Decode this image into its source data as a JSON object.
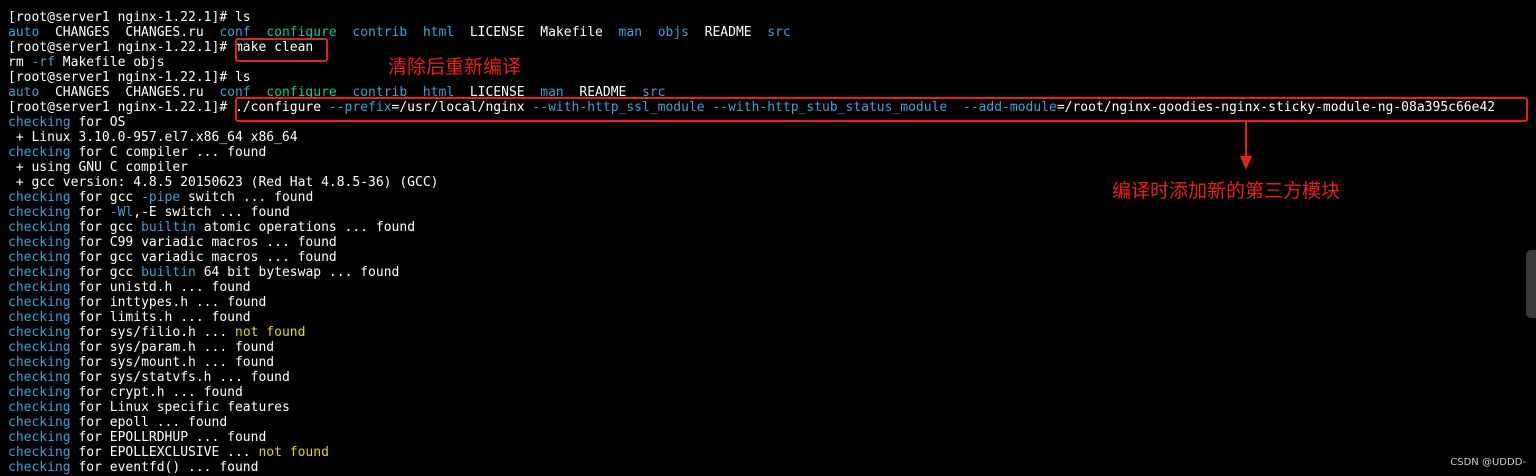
{
  "terminal": {
    "lines": [
      {
        "segments": [
          {
            "t": "[root@server1 nginx-1.22.1]# ls",
            "c": "w"
          }
        ]
      },
      {
        "segments": [
          {
            "t": "auto",
            "c": "c"
          },
          {
            "t": "  CHANGES  CHANGES.ru  ",
            "c": "w"
          },
          {
            "t": "conf",
            "c": "c"
          },
          {
            "t": "  ",
            "c": "w"
          },
          {
            "t": "configure",
            "c": "g"
          },
          {
            "t": "  ",
            "c": "w"
          },
          {
            "t": "contrib",
            "c": "c"
          },
          {
            "t": "  ",
            "c": "w"
          },
          {
            "t": "html",
            "c": "c"
          },
          {
            "t": "  LICENSE  Makefile  ",
            "c": "w"
          },
          {
            "t": "man",
            "c": "c"
          },
          {
            "t": "  ",
            "c": "w"
          },
          {
            "t": "objs",
            "c": "c"
          },
          {
            "t": "  README  ",
            "c": "w"
          },
          {
            "t": "src",
            "c": "c"
          }
        ]
      },
      {
        "segments": [
          {
            "t": "[root@server1 nginx-1.22.1]# make clean",
            "c": "w"
          }
        ]
      },
      {
        "segments": [
          {
            "t": "rm ",
            "c": "w"
          },
          {
            "t": "-rf",
            "c": "c"
          },
          {
            "t": " Makefile objs",
            "c": "w"
          }
        ]
      },
      {
        "segments": [
          {
            "t": "[root@server1 nginx-1.22.1]# ls",
            "c": "w"
          }
        ]
      },
      {
        "segments": [
          {
            "t": "auto",
            "c": "c"
          },
          {
            "t": "  CHANGES  CHANGES.ru  ",
            "c": "w"
          },
          {
            "t": "conf",
            "c": "c"
          },
          {
            "t": "  ",
            "c": "w"
          },
          {
            "t": "configure",
            "c": "g"
          },
          {
            "t": "  ",
            "c": "w"
          },
          {
            "t": "contrib",
            "c": "c"
          },
          {
            "t": "  ",
            "c": "w"
          },
          {
            "t": "html",
            "c": "c"
          },
          {
            "t": "  LICENSE  ",
            "c": "w"
          },
          {
            "t": "man",
            "c": "c"
          },
          {
            "t": "  README  ",
            "c": "w"
          },
          {
            "t": "src",
            "c": "c"
          }
        ]
      },
      {
        "segments": [
          {
            "t": "[root@server1 nginx-1.22.1]# ./configure ",
            "c": "w"
          },
          {
            "t": "--prefix",
            "c": "c"
          },
          {
            "t": "=/usr/local/nginx ",
            "c": "w"
          },
          {
            "t": "--with-http_ssl_module --with-http_stub_status_module  --add-module",
            "c": "c"
          },
          {
            "t": "=/root/nginx-goodies-nginx-sticky-module-ng-08a395c66e42",
            "c": "w"
          }
        ]
      },
      {
        "segments": [
          {
            "t": "checking",
            "c": "c"
          },
          {
            "t": " for OS",
            "c": "w"
          }
        ]
      },
      {
        "segments": [
          {
            "t": " + Linux 3.10.0-957.el7.x86_64 x86_64",
            "c": "w"
          }
        ]
      },
      {
        "segments": [
          {
            "t": "checking",
            "c": "c"
          },
          {
            "t": " for C compiler ... found",
            "c": "w"
          }
        ]
      },
      {
        "segments": [
          {
            "t": " + using GNU C compiler",
            "c": "w"
          }
        ]
      },
      {
        "segments": [
          {
            "t": " + gcc version: 4.8.5 20150623 (Red Hat 4.8.5-36) (GCC)",
            "c": "w"
          }
        ]
      },
      {
        "segments": [
          {
            "t": "checking",
            "c": "c"
          },
          {
            "t": " for gcc ",
            "c": "w"
          },
          {
            "t": "-pipe",
            "c": "c"
          },
          {
            "t": " switch ... found",
            "c": "w"
          }
        ]
      },
      {
        "segments": [
          {
            "t": "checking",
            "c": "c"
          },
          {
            "t": " for ",
            "c": "w"
          },
          {
            "t": "-Wl",
            "c": "c"
          },
          {
            "t": ",-E switch ... found",
            "c": "w"
          }
        ]
      },
      {
        "segments": [
          {
            "t": "checking",
            "c": "c"
          },
          {
            "t": " for gcc ",
            "c": "w"
          },
          {
            "t": "builtin",
            "c": "c"
          },
          {
            "t": " atomic operations ... found",
            "c": "w"
          }
        ]
      },
      {
        "segments": [
          {
            "t": "checking",
            "c": "c"
          },
          {
            "t": " for C99 variadic macros ... found",
            "c": "w"
          }
        ]
      },
      {
        "segments": [
          {
            "t": "checking",
            "c": "c"
          },
          {
            "t": " for gcc variadic macros ... found",
            "c": "w"
          }
        ]
      },
      {
        "segments": [
          {
            "t": "checking",
            "c": "c"
          },
          {
            "t": " for gcc ",
            "c": "w"
          },
          {
            "t": "builtin",
            "c": "c"
          },
          {
            "t": " 64 bit byteswap ... found",
            "c": "w"
          }
        ]
      },
      {
        "segments": [
          {
            "t": "checking",
            "c": "c"
          },
          {
            "t": " for unistd.h ... found",
            "c": "w"
          }
        ]
      },
      {
        "segments": [
          {
            "t": "checking",
            "c": "c"
          },
          {
            "t": " for inttypes.h ... found",
            "c": "w"
          }
        ]
      },
      {
        "segments": [
          {
            "t": "checking",
            "c": "c"
          },
          {
            "t": " for limits.h ... found",
            "c": "w"
          }
        ]
      },
      {
        "segments": [
          {
            "t": "checking",
            "c": "c"
          },
          {
            "t": " for sys/filio.h ... ",
            "c": "w"
          },
          {
            "t": "not found",
            "c": "y"
          }
        ]
      },
      {
        "segments": [
          {
            "t": "checking",
            "c": "c"
          },
          {
            "t": " for sys/param.h ... found",
            "c": "w"
          }
        ]
      },
      {
        "segments": [
          {
            "t": "checking",
            "c": "c"
          },
          {
            "t": " for sys/mount.h ... found",
            "c": "w"
          }
        ]
      },
      {
        "segments": [
          {
            "t": "checking",
            "c": "c"
          },
          {
            "t": " for sys/statvfs.h ... found",
            "c": "w"
          }
        ]
      },
      {
        "segments": [
          {
            "t": "checking",
            "c": "c"
          },
          {
            "t": " for crypt.h ... found",
            "c": "w"
          }
        ]
      },
      {
        "segments": [
          {
            "t": "checking",
            "c": "c"
          },
          {
            "t": " for Linux specific features",
            "c": "w"
          }
        ]
      },
      {
        "segments": [
          {
            "t": "checking",
            "c": "c"
          },
          {
            "t": " for epoll ... found",
            "c": "w"
          }
        ]
      },
      {
        "segments": [
          {
            "t": "checking",
            "c": "c"
          },
          {
            "t": " for EPOLLRDHUP ... found",
            "c": "w"
          }
        ]
      },
      {
        "segments": [
          {
            "t": "checking",
            "c": "c"
          },
          {
            "t": " for EPOLLEXCLUSIVE ... ",
            "c": "w"
          },
          {
            "t": "not found",
            "c": "y"
          }
        ]
      },
      {
        "segments": [
          {
            "t": "checking",
            "c": "c"
          },
          {
            "t": " for eventfd() ... found",
            "c": "w"
          }
        ]
      }
    ]
  },
  "annotations": {
    "clean_note": "清除后重新编译",
    "module_note": "编译时添加新的第三方模块"
  },
  "watermark": "CSDN @UDDD-",
  "colors": {
    "background": "#000000",
    "text": "#ffffff",
    "blue": "#3fa0d8",
    "green": "#16c79a",
    "yellow": "#e6d21e",
    "annotation_red": "#e8201a"
  }
}
